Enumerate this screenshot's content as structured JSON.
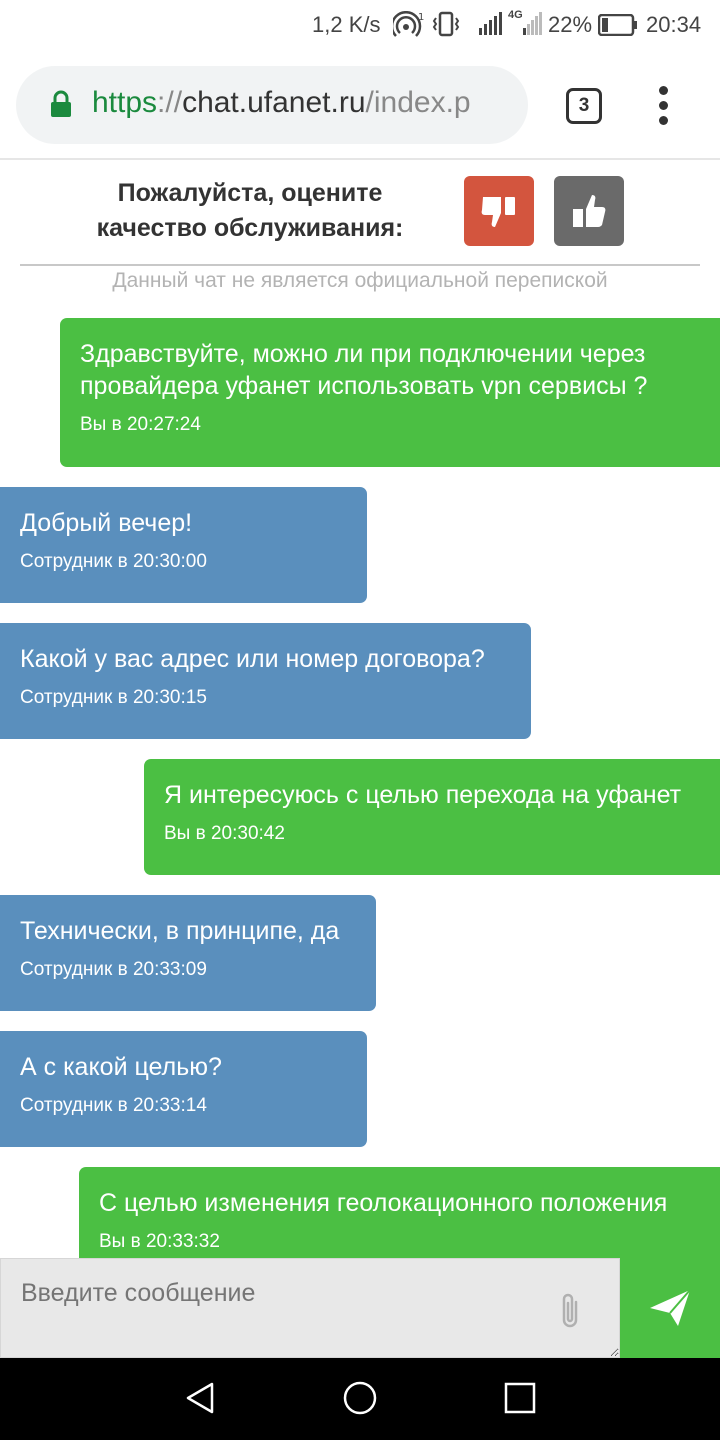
{
  "status_bar": {
    "net_speed": "1,2 K/s",
    "network_type": "4G",
    "battery_percent": "22%",
    "battery_level": 0.22,
    "time": "20:34"
  },
  "browser": {
    "url_scheme": "https",
    "url_separator": "://",
    "url_host": "chat.ufanet.ru",
    "url_path": "/index.p",
    "tab_count": "3"
  },
  "rating": {
    "prompt_line1": "Пожалуйста, оцените",
    "prompt_line2": "качество обслуживания:"
  },
  "disclaimer": "Данный чат не является официальной перепиской",
  "messages": [
    {
      "sender": "user",
      "text": "Здравствуйте, можно ли при подключении через провайдера уфанет использовать vpn сервисы ?",
      "meta": "Вы в 20:27:24"
    },
    {
      "sender": "agent",
      "text": "Добрый вечер!",
      "meta": "Сотрудник в 20:30:00"
    },
    {
      "sender": "agent",
      "text": "Какой у вас адрес или номер договора?",
      "meta": "Сотрудник в 20:30:15"
    },
    {
      "sender": "user",
      "text": "Я интересуюсь с целью перехода на уфанет",
      "meta": "Вы в 20:30:42"
    },
    {
      "sender": "agent",
      "text": "Технически, в принципе, да",
      "meta": "Сотрудник в 20:33:09"
    },
    {
      "sender": "agent",
      "text": "А с какой целью?",
      "meta": "Сотрудник в 20:33:14"
    },
    {
      "sender": "user",
      "text": "С целью изменения геолокационного положения",
      "meta": "Вы в 20:33:32"
    }
  ],
  "input": {
    "placeholder": "Введите сообщение"
  },
  "colors": {
    "user_bubble": "#4bbf43",
    "agent_bubble": "#5a8fbd",
    "dislike": "#d3553e",
    "like": "#6a6a6a",
    "secure_green": "#1b8a3e"
  }
}
